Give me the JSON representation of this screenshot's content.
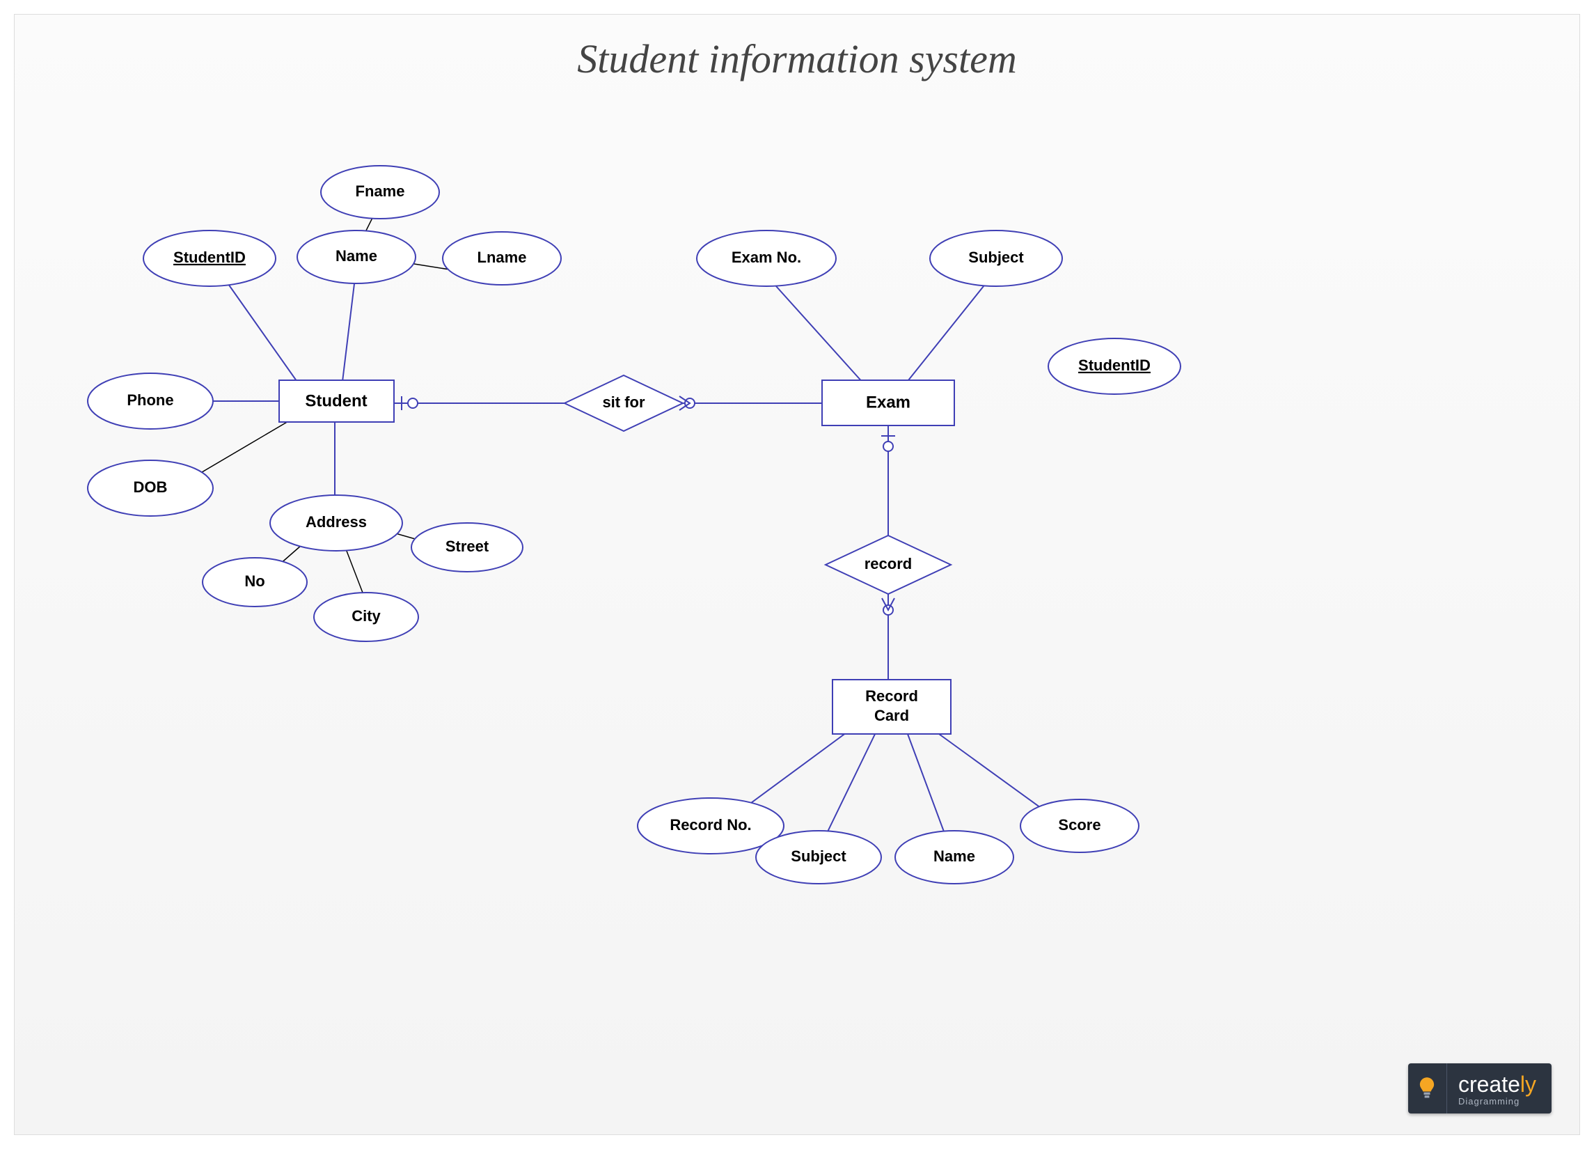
{
  "title": "Student information system",
  "entities": {
    "student": "Student",
    "exam": "Exam",
    "recordCard": "Record\nCard"
  },
  "relationships": {
    "sitfor": "sit for",
    "record": "record"
  },
  "attributes": {
    "studentId": "StudentID",
    "phone": "Phone",
    "dob": "DOB",
    "name": "Name",
    "fname": "Fname",
    "lname": "Lname",
    "address": "Address",
    "no": "No",
    "city": "City",
    "street": "Street",
    "examNo": "Exam No.",
    "subject": "Subject",
    "examStudentId": "StudentID",
    "recordNo": "Record No.",
    "recSubject": "Subject",
    "recName": "Name",
    "score": "Score"
  },
  "logo": {
    "brand1": "create",
    "brand2": "ly",
    "tagline": "Diagramming"
  }
}
